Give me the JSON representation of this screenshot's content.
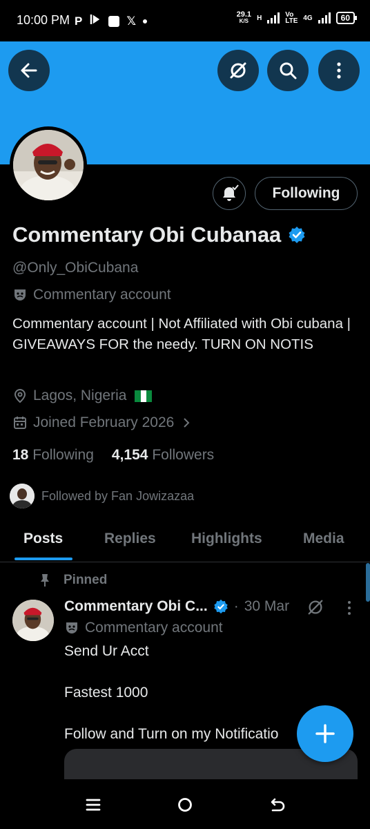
{
  "status_bar": {
    "time": "10:00 PM",
    "icons_left": [
      "paypal-p",
      "bolt-play",
      "square",
      "x-logo",
      "dot"
    ],
    "p_glyph": "P",
    "x_glyph": "𝕏",
    "speed_value": "29.1",
    "speed_unit": "K/S",
    "net_h": "H",
    "volte": "Vo LTE",
    "net_4g": "4G",
    "battery": "60"
  },
  "colors": {
    "accent": "#1d9bf0",
    "background": "#000000",
    "text_primary": "#e7e9ea",
    "text_secondary": "#71767b"
  },
  "profile": {
    "display_name": "Commentary Obi Cubanaa",
    "handle": "@Only_ObiCubana",
    "account_label": "Commentary account",
    "bio": "Commentary account | Not Affiliated with Obi cubana | GIVEAWAYS FOR the needy. TURN ON NOTIS",
    "location": "Lagos, Nigeria",
    "joined": "Joined February 2026",
    "following_count": "18",
    "following_label": "Following",
    "followers_count": "4,154",
    "followers_label": "Followers",
    "followed_by": "Followed by Fan Jowizazaa",
    "follow_button": "Following"
  },
  "tabs": [
    {
      "label": "Posts",
      "active": true
    },
    {
      "label": "Replies",
      "active": false
    },
    {
      "label": "Highlights",
      "active": false
    },
    {
      "label": "Media",
      "active": false
    }
  ],
  "post": {
    "pinned_label": "Pinned",
    "author": "Commentary Obi C...",
    "date_sep": "·",
    "date": "30 Mar",
    "account_label": "Commentary account",
    "body": "Send Ur Acct\n\nFastest 1000\n\nFollow and Turn on my Notificatio"
  },
  "fab": {
    "icon": "plus-icon"
  },
  "navbar": {
    "icons": [
      "recents-icon",
      "home-icon",
      "back-icon"
    ]
  }
}
